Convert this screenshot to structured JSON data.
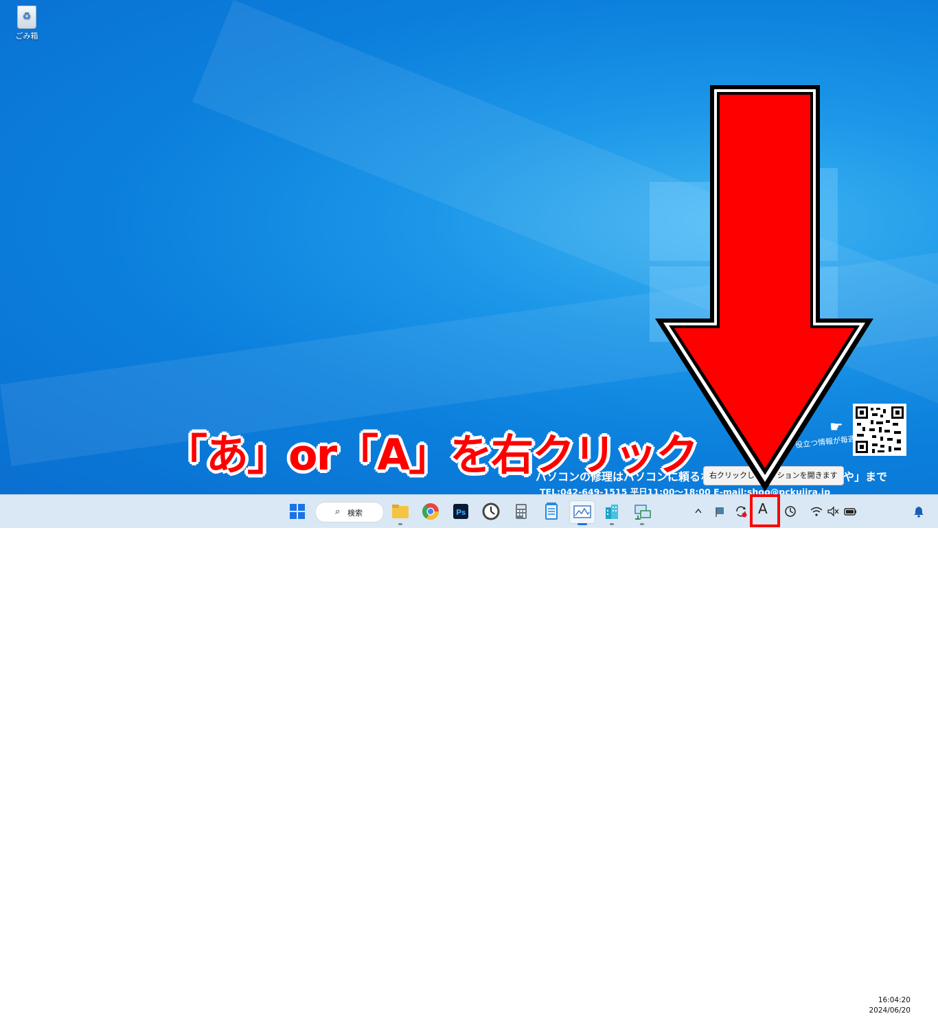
{
  "desktop": {
    "recycle_bin_label": "ごみ箱",
    "caption": "「あ」or「A」を右クリック",
    "promo_line1": "パソコンの修理はパソコンに頼るなら「パソコン修理のくじらや」まで",
    "promo_line2": "TEL:042-649-1515 平日11:00〜18:00 E-mail:shop@pckujira.jp",
    "promo_small": "役立つ情報が毎週更新!",
    "tooltip": "右クリックしてオプションを開きます"
  },
  "taskbar": {
    "search_label": "検索",
    "pinned_apps": [
      {
        "name": "start-button",
        "color": "#1a73e8"
      },
      {
        "name": "file-explorer-icon",
        "color": "#f4c542"
      },
      {
        "name": "chrome-icon",
        "color": "#e8453c"
      },
      {
        "name": "photoshop-icon",
        "color": "#0a1a33"
      },
      {
        "name": "clock-app-icon",
        "color": "#555555"
      },
      {
        "name": "calculator-icon",
        "color": "#6b7784"
      },
      {
        "name": "notepad-icon",
        "color": "#2b88d8"
      },
      {
        "name": "resource-monitor-icon",
        "color": "#3e7bbf"
      },
      {
        "name": "building-app-icon",
        "color": "#1fa3c8"
      },
      {
        "name": "network-app-icon",
        "color": "#2e8b57"
      }
    ],
    "tray": {
      "ime_indicator": "A",
      "time": "16:04:20",
      "date": "2024/06/20"
    }
  },
  "colors": {
    "highlight": "#ff0000",
    "arrow_fill": "#ff0000",
    "taskbar_bg": "#d9e8f4"
  }
}
